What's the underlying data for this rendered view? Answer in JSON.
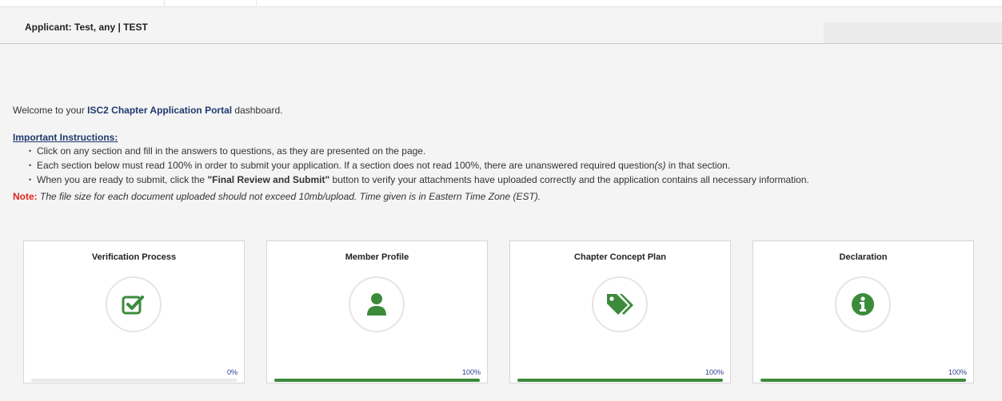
{
  "header": {
    "applicant_label": "Applicant: Test, any | TEST"
  },
  "intro": {
    "welcome_prefix": "Welcome to your ",
    "welcome_brand": "ISC2 Chapter Application Portal",
    "welcome_suffix": " dashboard.",
    "instructions_heading": "Important Instructions:",
    "instructions": {
      "item1": "Click on any section and fill in the answers to questions, as they are presented on the page.",
      "item2_main": "Each section below must read 100% in order to submit your application. If a section does not read 100%, there are unanswered required question",
      "item2_em": "(s)",
      "item2_end": " in that section.",
      "item3_prefix": "When you are ready to submit, click the ",
      "item3_button": "\"Final Review and Submit\"",
      "item3_suffix": " button to verify your attachments have uploaded correctly and the application contains all necessary information."
    },
    "note_label": "Note:",
    "note_text": " The file size for each document uploaded should not exceed 10mb/upload. Time given is in Eastern Time Zone (EST)."
  },
  "cards": [
    {
      "title": "Verification Process",
      "icon": "check-square-icon",
      "percent_label": "0%",
      "progress": 0
    },
    {
      "title": "Member Profile",
      "icon": "user-icon",
      "percent_label": "100%",
      "progress": 1.0
    },
    {
      "title": "Chapter Concept Plan",
      "icon": "tags-icon",
      "percent_label": "100%",
      "progress": 1.0
    },
    {
      "title": "Declaration",
      "icon": "info-circle-icon",
      "percent_label": "100%",
      "progress": 1.0
    }
  ],
  "colors": {
    "brand_blue": "#1f3a6e",
    "accent_green": "#3b8b3b",
    "note_red": "#e0231d",
    "percent_blue": "#2b3b8f"
  }
}
